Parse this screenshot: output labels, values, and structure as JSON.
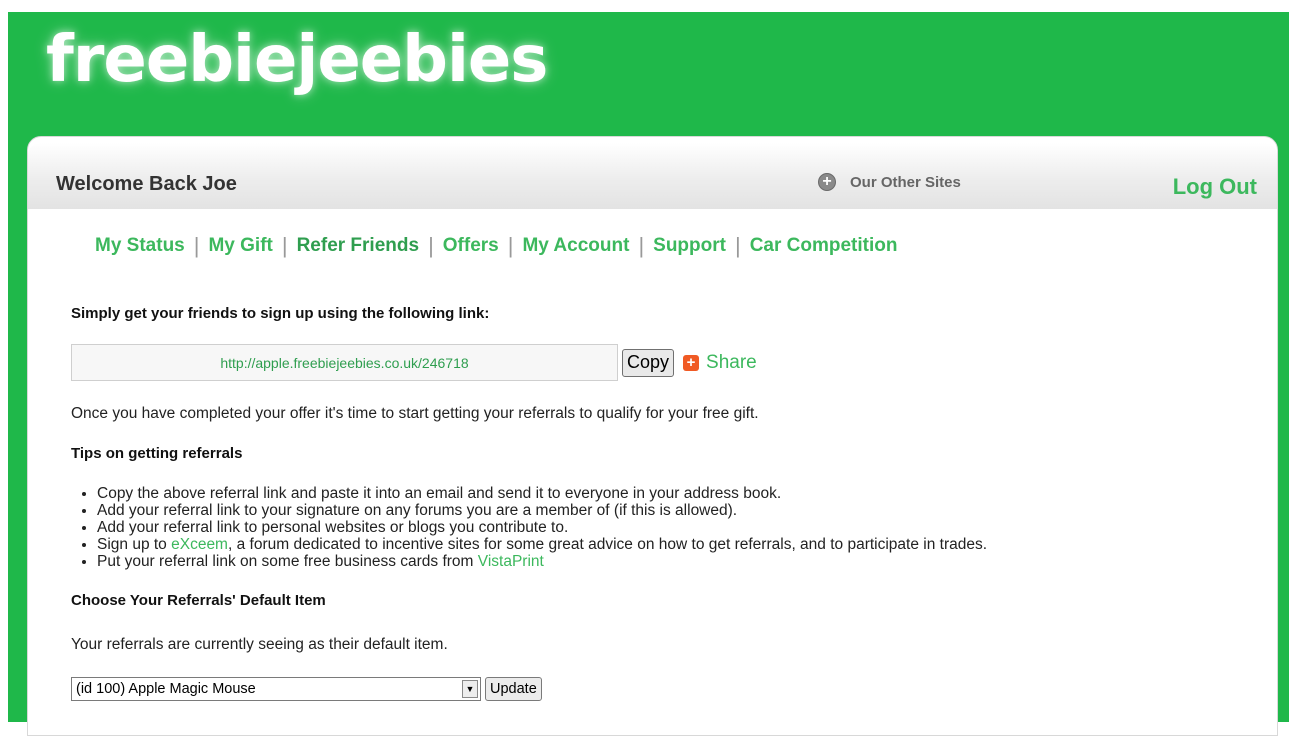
{
  "brand": {
    "logo_text": "freebiejeebies",
    "accent_color": "#1fb84a",
    "link_color": "#3cb85d"
  },
  "header": {
    "welcome": "Welcome Back Joe",
    "other_sites_label": "Our Other Sites",
    "other_sites_icon": "circle-plus-icon",
    "logout_label": "Log Out"
  },
  "nav": {
    "items": [
      {
        "label": "My Status"
      },
      {
        "label": "My Gift"
      },
      {
        "label": "Refer Friends"
      },
      {
        "label": "Offers"
      },
      {
        "label": "My Account"
      },
      {
        "label": "Support"
      },
      {
        "label": "Car Competition"
      }
    ]
  },
  "referral": {
    "heading": "Simply get your friends to sign up using the following link:",
    "link": "http://apple.freebiejeebies.co.uk/246718",
    "copy_label": "Copy",
    "share_label": "Share",
    "share_icon": "plus-square-icon"
  },
  "intro": "Once you have completed your offer it's time to start getting your referrals to qualify for your free gift.",
  "tips": {
    "heading": "Tips on getting referrals",
    "items": [
      {
        "text": "Copy the above referral link and paste it into an email and send it to everyone in your address book."
      },
      {
        "text": "Add your referral link to your signature on any forums you are a member of (if this is allowed)."
      },
      {
        "text": "Add your referral link to personal websites or blogs you contribute to."
      },
      {
        "pre": "Sign up to ",
        "link": "eXceem",
        "post": ", a forum dedicated to incentive sites for some great advice on how to get referrals, and to participate in trades."
      },
      {
        "pre": "Put your referral link on some free business cards from ",
        "link": "VistaPrint",
        "post": ""
      }
    ]
  },
  "default_item": {
    "heading": "Choose Your Referrals' Default Item",
    "description": "Your referrals are currently seeing as their default item.",
    "selected": "(id 100) Apple Magic Mouse",
    "update_label": "Update"
  }
}
